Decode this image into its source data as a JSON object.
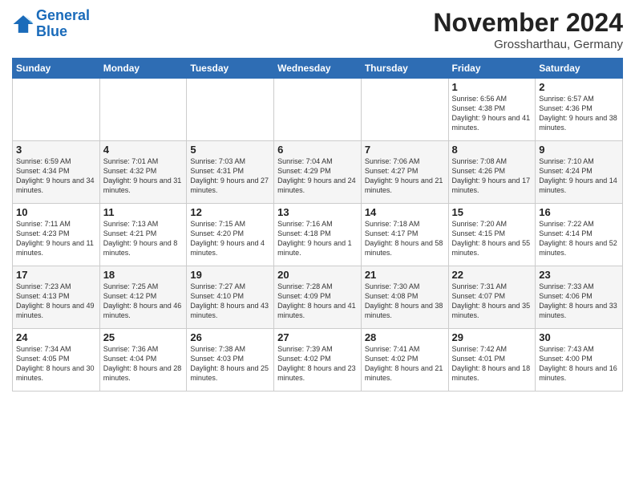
{
  "logo": {
    "line1": "General",
    "line2": "Blue"
  },
  "title": "November 2024",
  "location": "Grossharthau, Germany",
  "days_of_week": [
    "Sunday",
    "Monday",
    "Tuesday",
    "Wednesday",
    "Thursday",
    "Friday",
    "Saturday"
  ],
  "weeks": [
    [
      {
        "day": "",
        "info": ""
      },
      {
        "day": "",
        "info": ""
      },
      {
        "day": "",
        "info": ""
      },
      {
        "day": "",
        "info": ""
      },
      {
        "day": "",
        "info": ""
      },
      {
        "day": "1",
        "info": "Sunrise: 6:56 AM\nSunset: 4:38 PM\nDaylight: 9 hours\nand 41 minutes."
      },
      {
        "day": "2",
        "info": "Sunrise: 6:57 AM\nSunset: 4:36 PM\nDaylight: 9 hours\nand 38 minutes."
      }
    ],
    [
      {
        "day": "3",
        "info": "Sunrise: 6:59 AM\nSunset: 4:34 PM\nDaylight: 9 hours\nand 34 minutes."
      },
      {
        "day": "4",
        "info": "Sunrise: 7:01 AM\nSunset: 4:32 PM\nDaylight: 9 hours\nand 31 minutes."
      },
      {
        "day": "5",
        "info": "Sunrise: 7:03 AM\nSunset: 4:31 PM\nDaylight: 9 hours\nand 27 minutes."
      },
      {
        "day": "6",
        "info": "Sunrise: 7:04 AM\nSunset: 4:29 PM\nDaylight: 9 hours\nand 24 minutes."
      },
      {
        "day": "7",
        "info": "Sunrise: 7:06 AM\nSunset: 4:27 PM\nDaylight: 9 hours\nand 21 minutes."
      },
      {
        "day": "8",
        "info": "Sunrise: 7:08 AM\nSunset: 4:26 PM\nDaylight: 9 hours\nand 17 minutes."
      },
      {
        "day": "9",
        "info": "Sunrise: 7:10 AM\nSunset: 4:24 PM\nDaylight: 9 hours\nand 14 minutes."
      }
    ],
    [
      {
        "day": "10",
        "info": "Sunrise: 7:11 AM\nSunset: 4:23 PM\nDaylight: 9 hours\nand 11 minutes."
      },
      {
        "day": "11",
        "info": "Sunrise: 7:13 AM\nSunset: 4:21 PM\nDaylight: 9 hours\nand 8 minutes."
      },
      {
        "day": "12",
        "info": "Sunrise: 7:15 AM\nSunset: 4:20 PM\nDaylight: 9 hours\nand 4 minutes."
      },
      {
        "day": "13",
        "info": "Sunrise: 7:16 AM\nSunset: 4:18 PM\nDaylight: 9 hours\nand 1 minute."
      },
      {
        "day": "14",
        "info": "Sunrise: 7:18 AM\nSunset: 4:17 PM\nDaylight: 8 hours\nand 58 minutes."
      },
      {
        "day": "15",
        "info": "Sunrise: 7:20 AM\nSunset: 4:15 PM\nDaylight: 8 hours\nand 55 minutes."
      },
      {
        "day": "16",
        "info": "Sunrise: 7:22 AM\nSunset: 4:14 PM\nDaylight: 8 hours\nand 52 minutes."
      }
    ],
    [
      {
        "day": "17",
        "info": "Sunrise: 7:23 AM\nSunset: 4:13 PM\nDaylight: 8 hours\nand 49 minutes."
      },
      {
        "day": "18",
        "info": "Sunrise: 7:25 AM\nSunset: 4:12 PM\nDaylight: 8 hours\nand 46 minutes."
      },
      {
        "day": "19",
        "info": "Sunrise: 7:27 AM\nSunset: 4:10 PM\nDaylight: 8 hours\nand 43 minutes."
      },
      {
        "day": "20",
        "info": "Sunrise: 7:28 AM\nSunset: 4:09 PM\nDaylight: 8 hours\nand 41 minutes."
      },
      {
        "day": "21",
        "info": "Sunrise: 7:30 AM\nSunset: 4:08 PM\nDaylight: 8 hours\nand 38 minutes."
      },
      {
        "day": "22",
        "info": "Sunrise: 7:31 AM\nSunset: 4:07 PM\nDaylight: 8 hours\nand 35 minutes."
      },
      {
        "day": "23",
        "info": "Sunrise: 7:33 AM\nSunset: 4:06 PM\nDaylight: 8 hours\nand 33 minutes."
      }
    ],
    [
      {
        "day": "24",
        "info": "Sunrise: 7:34 AM\nSunset: 4:05 PM\nDaylight: 8 hours\nand 30 minutes."
      },
      {
        "day": "25",
        "info": "Sunrise: 7:36 AM\nSunset: 4:04 PM\nDaylight: 8 hours\nand 28 minutes."
      },
      {
        "day": "26",
        "info": "Sunrise: 7:38 AM\nSunset: 4:03 PM\nDaylight: 8 hours\nand 25 minutes."
      },
      {
        "day": "27",
        "info": "Sunrise: 7:39 AM\nSunset: 4:02 PM\nDaylight: 8 hours\nand 23 minutes."
      },
      {
        "day": "28",
        "info": "Sunrise: 7:41 AM\nSunset: 4:02 PM\nDaylight: 8 hours\nand 21 minutes."
      },
      {
        "day": "29",
        "info": "Sunrise: 7:42 AM\nSunset: 4:01 PM\nDaylight: 8 hours\nand 18 minutes."
      },
      {
        "day": "30",
        "info": "Sunrise: 7:43 AM\nSunset: 4:00 PM\nDaylight: 8 hours\nand 16 minutes."
      }
    ]
  ]
}
